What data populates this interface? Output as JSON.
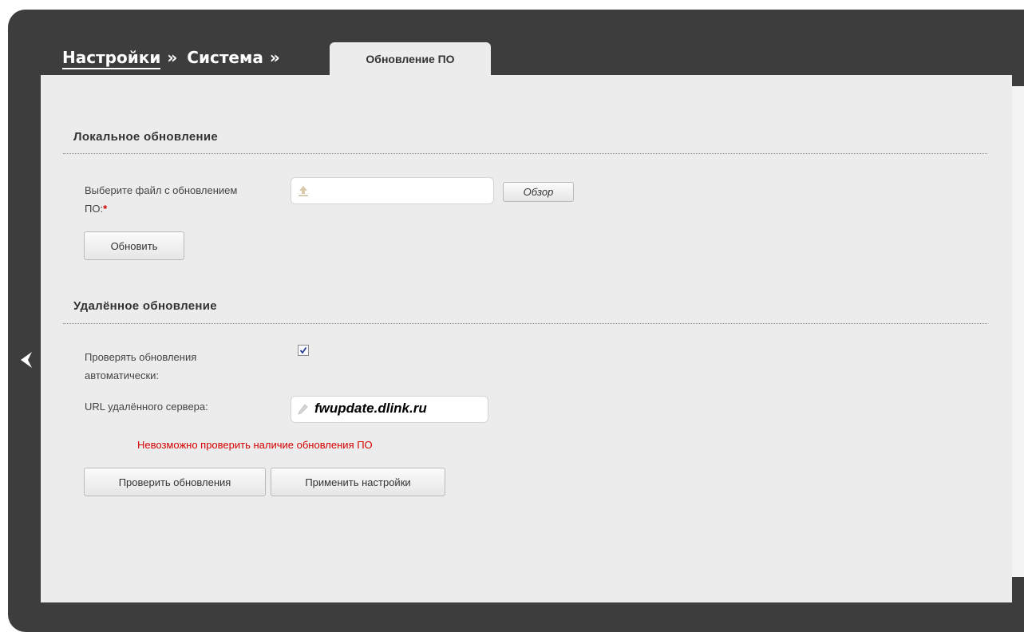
{
  "breadcrumb": {
    "item1": "Настройки",
    "item2": "Система",
    "separator": "»"
  },
  "tab": {
    "label": "Обновление ПО"
  },
  "local_update": {
    "title": "Локальное обновление",
    "file_label_line1": "Выберите файл с обновлением",
    "file_label_line2": "ПО:",
    "required_mark": "*",
    "browse_label": "Обзор",
    "update_label": "Обновить"
  },
  "remote_update": {
    "title": "Удалённое обновление",
    "auto_check_line1": "Проверять обновления",
    "auto_check_line2": "автоматически:",
    "auto_check_checked": true,
    "url_label": "URL удалённого сервера:",
    "url_value": "fwupdate.dlink.ru",
    "error_message": "Невозможно проверить наличие обновления ПО",
    "check_label": "Проверить обновления",
    "apply_label": "Применить настройки"
  },
  "icons": {
    "upload": "upload-icon",
    "pencil": "pencil-icon",
    "back": "chevron-left-icon",
    "check": "checkmark-icon"
  },
  "colors": {
    "frame": "#3d3d3d",
    "panel": "#ececec",
    "error": "#d30000"
  }
}
